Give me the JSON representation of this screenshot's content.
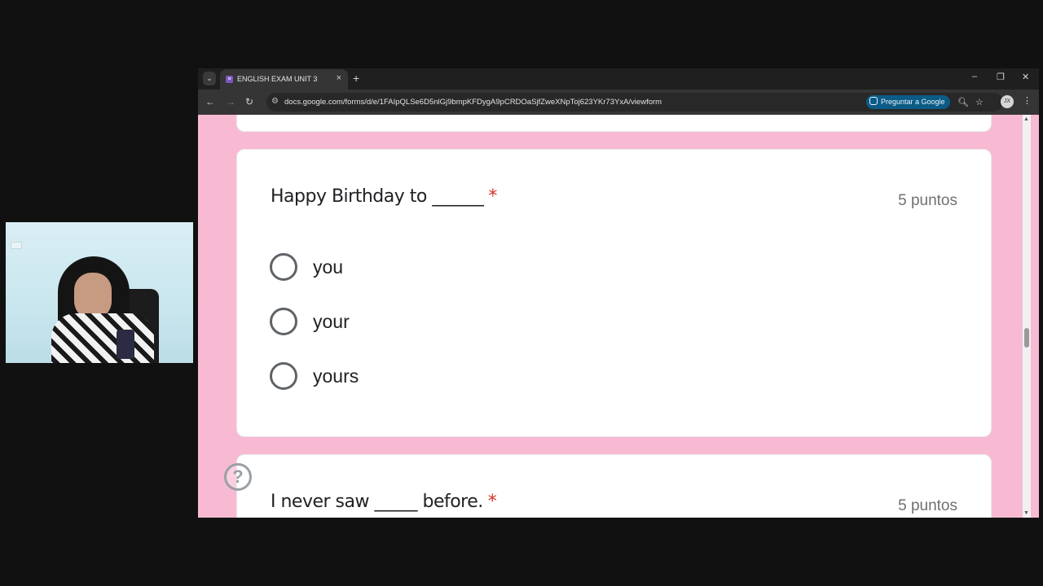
{
  "browser": {
    "tab_title": "ENGLISH EXAM UNIT 3",
    "tab_close": "×",
    "new_tab": "+",
    "tab_list": "⌄",
    "url": "docs.google.com/forms/d/e/1FAIpQLSe6D5nlGj9bmpKFDygA9pCRDOaSjfZweXNpToj623YKr73YxA/viewform",
    "ask_google_label": "Preguntar a Google",
    "profile_initials": "JX",
    "window_controls": {
      "minimize": "–",
      "restore": "❐",
      "close": "✕"
    },
    "nav": {
      "back": "←",
      "forward": "→",
      "reload": "↻"
    },
    "icons": {
      "zoom": "🔍︎",
      "star": "☆",
      "menu": "⋮",
      "site_info": "⚙"
    }
  },
  "form": {
    "questions": [
      {
        "title": "Happy Birthday to ______",
        "required_mark": "*",
        "points": "5 puntos",
        "options": [
          "you",
          "your",
          "yours"
        ]
      },
      {
        "title": "I never saw _____ before.",
        "required_mark": "*",
        "points": "5 puntos"
      }
    ],
    "help_icon": "?"
  },
  "colors": {
    "page_background": "#f8bad3",
    "required": "#d93025",
    "accent_button": "#0b5b86"
  }
}
